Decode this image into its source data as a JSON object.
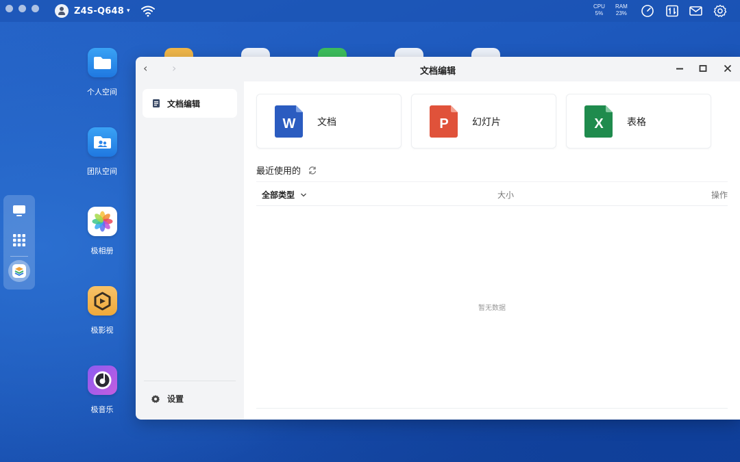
{
  "topbar": {
    "device_name": "Z4S-Q648",
    "cpu_label": "CPU",
    "cpu_value": "5%",
    "ram_label": "RAM",
    "ram_value": "23%"
  },
  "desktop": {
    "apps": [
      {
        "label": "个人空间",
        "icon": "folder-icon"
      },
      {
        "label": "团队空间",
        "icon": "team-folder-icon"
      },
      {
        "label": "极相册",
        "icon": "photos-icon"
      },
      {
        "label": "极影视",
        "icon": "video-icon"
      },
      {
        "label": "极音乐",
        "icon": "music-icon"
      }
    ]
  },
  "window": {
    "title": "文档编辑",
    "sidebar": {
      "active_item": "文档编辑",
      "settings": "设置"
    },
    "cards": [
      {
        "label": "文档",
        "letter": "W",
        "color": "#2b5cc0"
      },
      {
        "label": "幻灯片",
        "letter": "P",
        "color": "#e0523a"
      },
      {
        "label": "表格",
        "letter": "X",
        "color": "#1f8b4d"
      }
    ],
    "recent_title": "最近使用的",
    "table": {
      "type_filter": "全部类型",
      "size_col": "大小",
      "op_col": "操作"
    },
    "empty_text": "暂无数据"
  }
}
